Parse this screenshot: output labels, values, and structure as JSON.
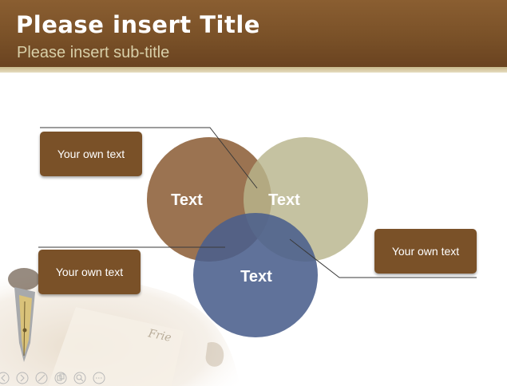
{
  "slide": {
    "title": "Please insert Title",
    "subtitle": "Please insert sub-title"
  },
  "diagram": {
    "circles": [
      {
        "label": "Text",
        "color": "#8a5b32"
      },
      {
        "label": "Text",
        "color": "#b8b48c"
      },
      {
        "label": "Text",
        "color": "#4a5e8c"
      }
    ],
    "callouts": [
      {
        "text": "Your own text"
      },
      {
        "text": "Your own text"
      },
      {
        "text": "Your own text"
      }
    ]
  },
  "decor": {
    "handwriting": "Frie"
  },
  "colors": {
    "header": "#7a5128",
    "callout": "#7a5128",
    "subtitle": "#d8cfa8"
  },
  "nav_icons": [
    "prev-icon",
    "next-icon",
    "pen-icon",
    "copy-icon",
    "zoom-icon",
    "more-icon"
  ]
}
